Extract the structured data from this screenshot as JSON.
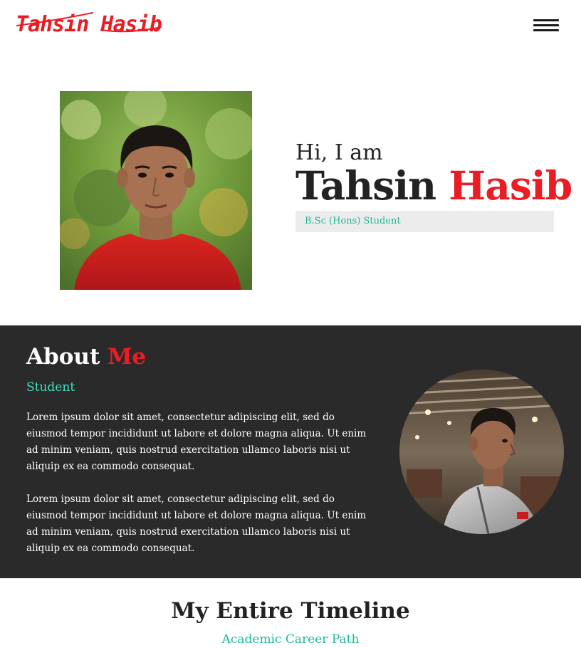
{
  "header": {
    "logo_text": "Tahsin Hasib",
    "menu_icon": "hamburger-menu-icon"
  },
  "hero": {
    "greeting": "Hi, I am",
    "first_name": "Tahsin",
    "last_name": "Hasib",
    "role": "B.Sc (Hons) Student"
  },
  "about": {
    "title_main": "About",
    "title_accent": "Me",
    "subtitle": "Student",
    "paragraphs": [
      "Lorem ipsum dolor sit amet, consectetur adipiscing elit, sed do eiusmod tempor incididunt ut labore et dolore magna aliqua. Ut enim ad minim veniam, quis nostrud exercitation ullamco laboris nisi ut aliquip ex ea commodo consequat.",
      "Lorem ipsum dolor sit amet, consectetur adipiscing elit, sed do eiusmod tempor incididunt ut labore et dolore magna aliqua. Ut enim ad minim veniam, quis nostrud exercitation ullamco laboris nisi ut aliquip ex ea commodo consequat."
    ]
  },
  "timeline": {
    "title": "My Entire Timeline",
    "subtitle": "Academic Career Path"
  },
  "colors": {
    "accent_red": "#ea1c24",
    "accent_teal": "#1fb89a",
    "dark_bg": "#2b2a2a"
  }
}
